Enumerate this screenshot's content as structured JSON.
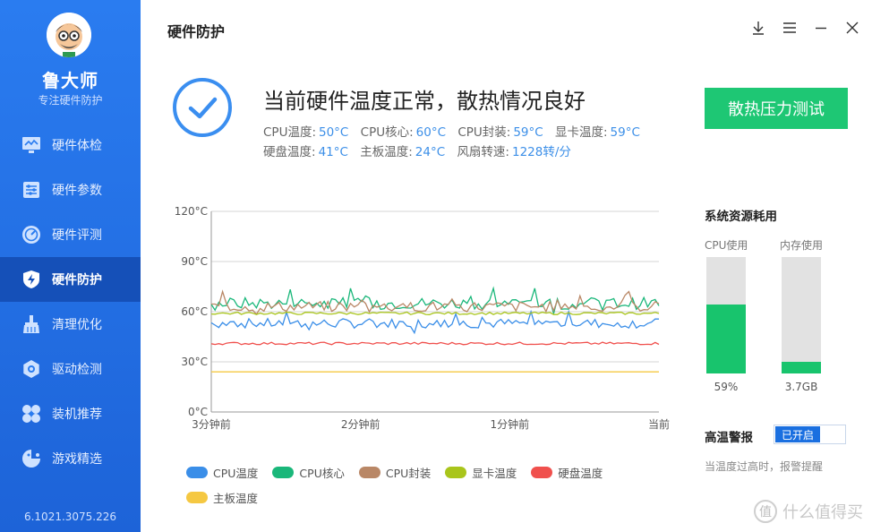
{
  "sidebar": {
    "brand": "鲁大师",
    "subtitle": "专注硬件防护",
    "items": [
      {
        "label": "硬件体检",
        "icon": "monitor-icon"
      },
      {
        "label": "硬件参数",
        "icon": "sliders-icon"
      },
      {
        "label": "硬件评测",
        "icon": "gauge-icon"
      },
      {
        "label": "硬件防护",
        "icon": "shield-bolt-icon",
        "active": true
      },
      {
        "label": "清理优化",
        "icon": "broom-icon"
      },
      {
        "label": "驱动检测",
        "icon": "gear-icon"
      },
      {
        "label": "装机推荐",
        "icon": "fan-icon"
      },
      {
        "label": "游戏精选",
        "icon": "gamepad-icon"
      }
    ],
    "version": "6.1021.3075.226"
  },
  "header": {
    "title": "硬件防护",
    "buttons": [
      "download-icon",
      "menu-icon",
      "minimize-icon",
      "close-icon"
    ]
  },
  "status": {
    "title": "当前硬件温度正常，散热情况良好",
    "metrics": [
      {
        "label": "CPU温度:",
        "value": "50°C"
      },
      {
        "label": "CPU核心:",
        "value": "60°C"
      },
      {
        "label": "CPU封装:",
        "value": "59°C"
      },
      {
        "label": "显卡温度:",
        "value": "59°C"
      },
      {
        "label": "硬盘温度:",
        "value": "41°C"
      },
      {
        "label": "主板温度:",
        "value": "24°C"
      },
      {
        "label": "风扇转速:",
        "value": "1228转/分"
      }
    ],
    "button": "散热压力测试"
  },
  "chart_data": {
    "type": "line",
    "y_ticks": [
      "120°C",
      "90°C",
      "60°C",
      "30°C",
      "0°C"
    ],
    "ylim": [
      0,
      120
    ],
    "x_ticks": [
      "3分钟前",
      "2分钟前",
      "1分钟前",
      "当前"
    ],
    "grid": true,
    "legend_position": "bottom",
    "series": [
      {
        "name": "CPU温度",
        "color": "#3a8ee8",
        "approx_range": [
          47,
          60
        ],
        "typical": 53
      },
      {
        "name": "CPU核心",
        "color": "#1ab77a",
        "approx_range": [
          58,
          74
        ],
        "typical": 65
      },
      {
        "name": "CPU封装",
        "color": "#b98766",
        "approx_range": [
          58,
          72
        ],
        "typical": 63
      },
      {
        "name": "显卡温度",
        "color": "#a9c51b",
        "approx_range": [
          57,
          61
        ],
        "typical": 59
      },
      {
        "name": "硬盘温度",
        "color": "#f0504d",
        "approx_range": [
          40,
          42
        ],
        "typical": 41
      },
      {
        "name": "主板温度",
        "color": "#f5c842",
        "approx_range": [
          24,
          24
        ],
        "typical": 24
      }
    ]
  },
  "resources": {
    "title": "系统资源耗用",
    "cpu": {
      "label": "CPU使用",
      "value": "59%",
      "fraction": 0.59
    },
    "memory": {
      "label": "内存使用",
      "value": "3.7GB",
      "fraction": 0.1
    }
  },
  "alarm": {
    "title": "高温警报",
    "toggle": "已开启",
    "desc": "当温度过高时，报警提醒"
  },
  "watermark": "什么值得买"
}
